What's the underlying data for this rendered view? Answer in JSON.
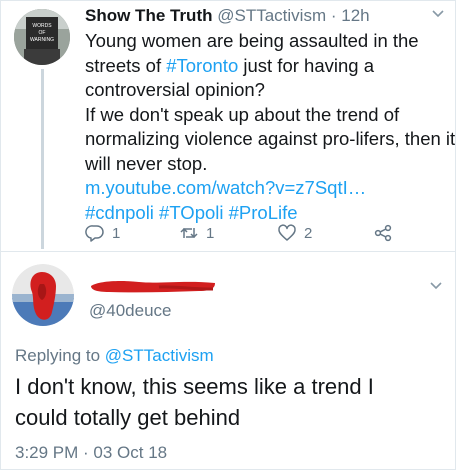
{
  "tweet1": {
    "display_name": "Show The Truth",
    "handle": "@STTactivism",
    "separator": "·",
    "time": "12h",
    "avatar_sign_lines": [
      "WORDS",
      "OF",
      "WARNING"
    ],
    "lines": [
      [
        "Young women are being assaulted in the"
      ],
      [
        "streets of ",
        "#Toronto",
        " just for having a"
      ],
      [
        "controversial opinion?"
      ],
      [
        "If we don't speak up about the trend of"
      ],
      [
        "normalizing violence against pro-lifers, then it"
      ],
      [
        "will never stop."
      ],
      [
        "",
        "m.youtube.com/watch?v=z7SqtI…",
        ""
      ],
      [
        "",
        "#cdnpoli #TOpoli #ProLife",
        ""
      ]
    ],
    "replies_count": "1",
    "retweets_count": "1",
    "likes_count": "2"
  },
  "tweet2": {
    "handle": "@40deuce",
    "replying_prefix": "Replying to ",
    "replying_to": "@STTactivism",
    "lines": [
      "I don't know, this seems like a trend I",
      "could totally get behind"
    ],
    "timestamp": "3:29 PM · 03 Oct 18"
  },
  "colors": {
    "link": "#1da1f2",
    "muted": "#657786",
    "redaction": "#d21f1f"
  },
  "icons": [
    "reply-icon",
    "retweet-icon",
    "like-icon",
    "share-icon",
    "chevron-down-icon"
  ]
}
